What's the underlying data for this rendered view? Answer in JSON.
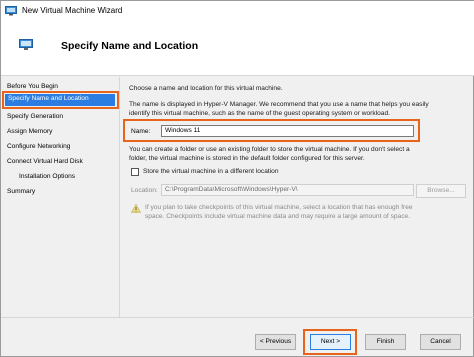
{
  "window": {
    "title": "New Virtual Machine Wizard"
  },
  "header": {
    "title": "Specify Name and Location"
  },
  "sidebar": {
    "items": [
      {
        "label": "Before You Begin"
      },
      {
        "label": "Specify Name and Location"
      },
      {
        "label": "Specify Generation"
      },
      {
        "label": "Assign Memory"
      },
      {
        "label": "Configure Networking"
      },
      {
        "label": "Connect Virtual Hard Disk"
      },
      {
        "label": "Installation Options"
      },
      {
        "label": "Summary"
      }
    ],
    "selected": "Specify Name and Location"
  },
  "content": {
    "intro": "Choose a name and location for this virtual machine.",
    "desc_line1": "The name is displayed in Hyper-V Manager. We recommend that you use a name that helps you easily",
    "desc_line2": "identify this virtual machine, such as the name of the guest operating system or workload.",
    "name_label": "Name:",
    "name_value": "Windows 11",
    "folder_line1": "You can create a folder or use an existing folder to store the virtual machine. If you don't select a",
    "folder_line2": "folder, the virtual machine is stored in the default folder configured for this server.",
    "store_checkbox_label": "Store the virtual machine in a different location",
    "store_checked": false,
    "location_label": "Location:",
    "location_value": "C:\\ProgramData\\Microsoft\\Windows\\Hyper-V\\",
    "browse_label": "Browse...",
    "warning_line1": "If you plan to take checkpoints of this virtual machine, select a location that has enough free",
    "warning_line2": "space. Checkpoints include virtual machine data and may require a large amount of space."
  },
  "buttons": {
    "previous": "< Previous",
    "next": "Next >",
    "finish": "Finish",
    "cancel": "Cancel"
  },
  "colors": {
    "selection": "#2b7de1",
    "highlight": "#e8631c"
  }
}
